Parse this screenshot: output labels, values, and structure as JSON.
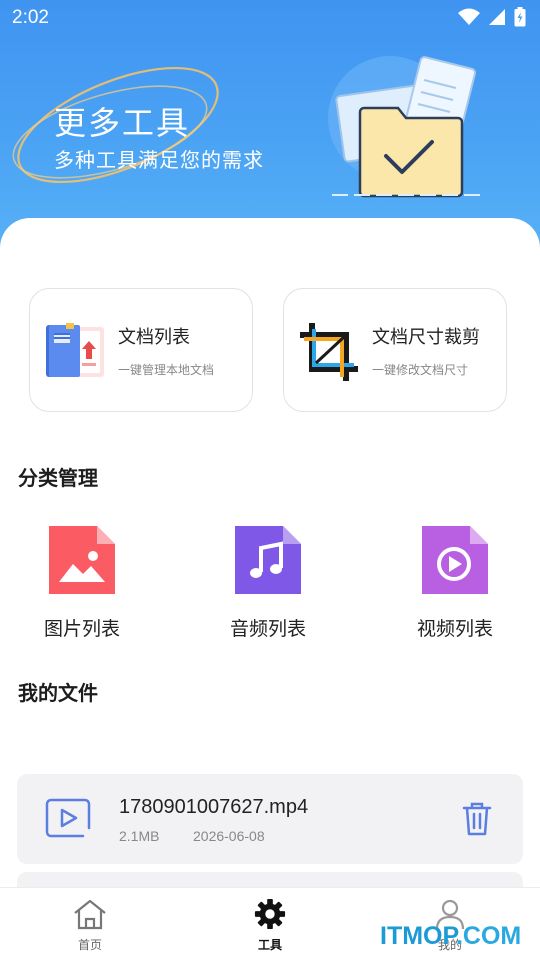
{
  "status": {
    "time": "2:02"
  },
  "hero": {
    "title": "更多工具",
    "subtitle": "多种工具满足您的需求"
  },
  "tools": [
    {
      "name": "文档列表",
      "desc": "一键管理本地文档",
      "icon": "document-list-icon"
    },
    {
      "name": "文档尺寸裁剪",
      "desc": "一键修改文档尺寸",
      "icon": "crop-icon"
    }
  ],
  "category_section": {
    "title": "分类管理"
  },
  "categories": [
    {
      "label": "图片列表",
      "icon": "image-file-icon",
      "color": "#fb5c63"
    },
    {
      "label": "音频列表",
      "icon": "audio-file-icon",
      "color": "#7f58e8"
    },
    {
      "label": "视频列表",
      "icon": "video-file-icon",
      "color": "#b95fe2"
    }
  ],
  "files_section": {
    "title": "我的文件"
  },
  "files": [
    {
      "name": "1780901007627.mp4",
      "size": "2.1MB",
      "date": "2026-06-08"
    }
  ],
  "tabs": [
    {
      "label": "首页",
      "icon": "home-icon"
    },
    {
      "label": "工具",
      "icon": "gear-icon",
      "active": true
    },
    {
      "label": "我的",
      "icon": "profile-icon"
    }
  ],
  "watermark": {
    "part1": "ITMOP",
    "part2": ".COM"
  },
  "colors": {
    "accent": "#4b9ff2",
    "file_icon": "#5b7fe0"
  }
}
